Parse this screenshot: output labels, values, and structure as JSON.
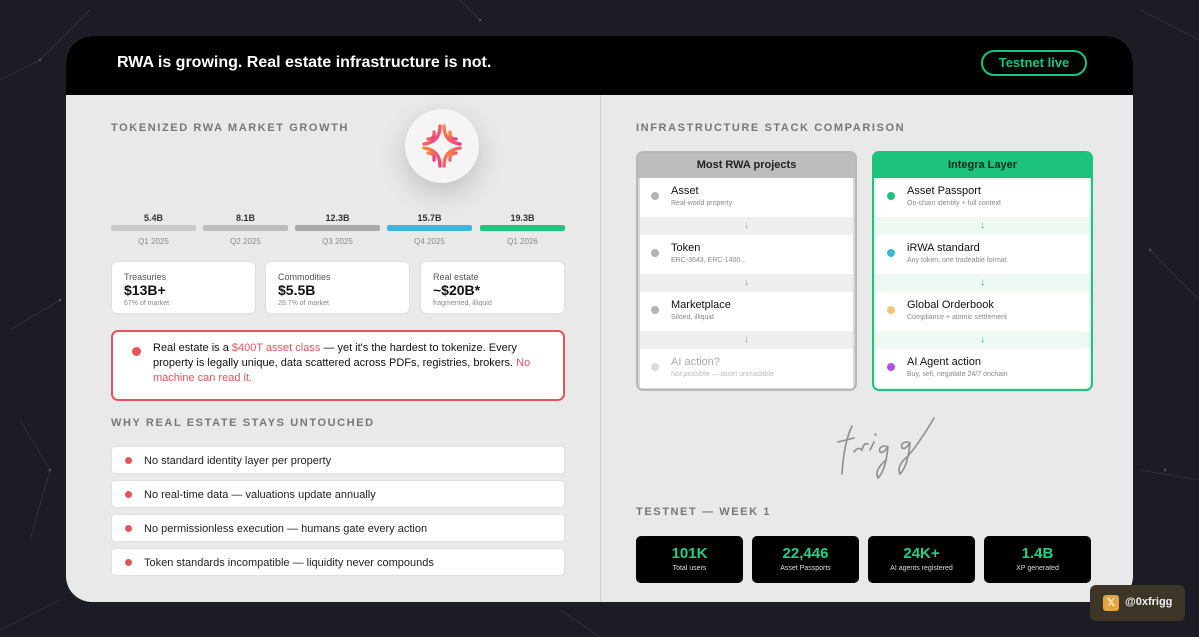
{
  "header": {
    "title": "RWA is growing. Real estate infrastructure is not.",
    "status_pill": "Testnet live"
  },
  "market": {
    "section_label": "TOKENIZED RWA MARKET GROWTH",
    "bars": [
      {
        "value": "5.4B",
        "quarter": "Q1 2025",
        "amount": 5.4,
        "color": "#c9c9c9"
      },
      {
        "value": "8.1B",
        "quarter": "Q2 2025",
        "amount": 8.1,
        "color": "#bdbdbd"
      },
      {
        "value": "12.3B",
        "quarter": "Q3 2025",
        "amount": 12.3,
        "color": "#a9a9a9"
      },
      {
        "value": "15.7B",
        "quarter": "Q4 2025",
        "amount": 15.7,
        "color": "#3cb6dc"
      },
      {
        "value": "19.3B",
        "quarter": "Q1 2026",
        "amount": 19.3,
        "color": "#1fc77e"
      }
    ],
    "stats": [
      {
        "label": "Treasuries",
        "value": "$13B+",
        "sub": "67% of market"
      },
      {
        "label": "Commodities",
        "value": "$5.5B",
        "sub": "28.7% of market"
      },
      {
        "label": "Real estate",
        "value": "~$20B*",
        "sub": "fragmented, illiquid"
      }
    ]
  },
  "alert": {
    "text_1": "Real estate is a ",
    "highlight": "$400T asset class",
    "text_2": " — yet it's the hardest to tokenize. Every property is legally unique, data scattered across PDFs, registries, brokers. ",
    "emphasis": "No machine can read it."
  },
  "reasons": {
    "section_label": "WHY REAL ESTATE STAYS UNTOUCHED",
    "items": [
      "No standard identity layer per property",
      "No real-time data — valuations update annually",
      "No permissionless execution — humans gate every action",
      "Token standards incompatible — liquidity never compounds"
    ]
  },
  "comparison": {
    "section_label": "INFRASTRUCTURE STACK COMPARISON",
    "left": {
      "title": "Most RWA projects",
      "rows": [
        {
          "name": "Asset",
          "desc": "Real-world property",
          "color": "#b3b3b3"
        },
        {
          "name": "Token",
          "desc": "ERC-3643, ERC-1400...",
          "color": "#b3b3b3"
        },
        {
          "name": "Marketplace",
          "desc": "Siloed, illiquid",
          "color": "#b3b3b3"
        },
        {
          "name": "AI action?",
          "desc": "Not possible — asset unreadable",
          "color": "#dcdcdc"
        }
      ]
    },
    "right": {
      "title": "Integra Layer",
      "rows": [
        {
          "name": "Asset Passport",
          "desc": "On-chain identity + full context",
          "color": "#1dc27c"
        },
        {
          "name": "iRWA standard",
          "desc": "Any token, one tradeable format",
          "color": "#3cb6dc"
        },
        {
          "name": "Global Orderbook",
          "desc": "Compliance + atomic settlement",
          "color": "#f2c27a"
        },
        {
          "name": "AI Agent action",
          "desc": "Buy, sell, negotiate 24/7 onchain",
          "color": "#b74fe0"
        }
      ]
    },
    "arrow": "↓"
  },
  "testnet": {
    "section_label": "TESTNET — WEEK 1",
    "metrics": [
      {
        "value": "101K",
        "caption": "Total users"
      },
      {
        "value": "22,446",
        "caption": "Asset Passports"
      },
      {
        "value": "24K+",
        "caption": "AI agents registered"
      },
      {
        "value": "1.4B",
        "caption": "XP generated"
      }
    ]
  },
  "signature": "frigg",
  "social": {
    "icon": "x-icon",
    "glyph": "𝕏",
    "handle": "@0xfrigg"
  }
}
